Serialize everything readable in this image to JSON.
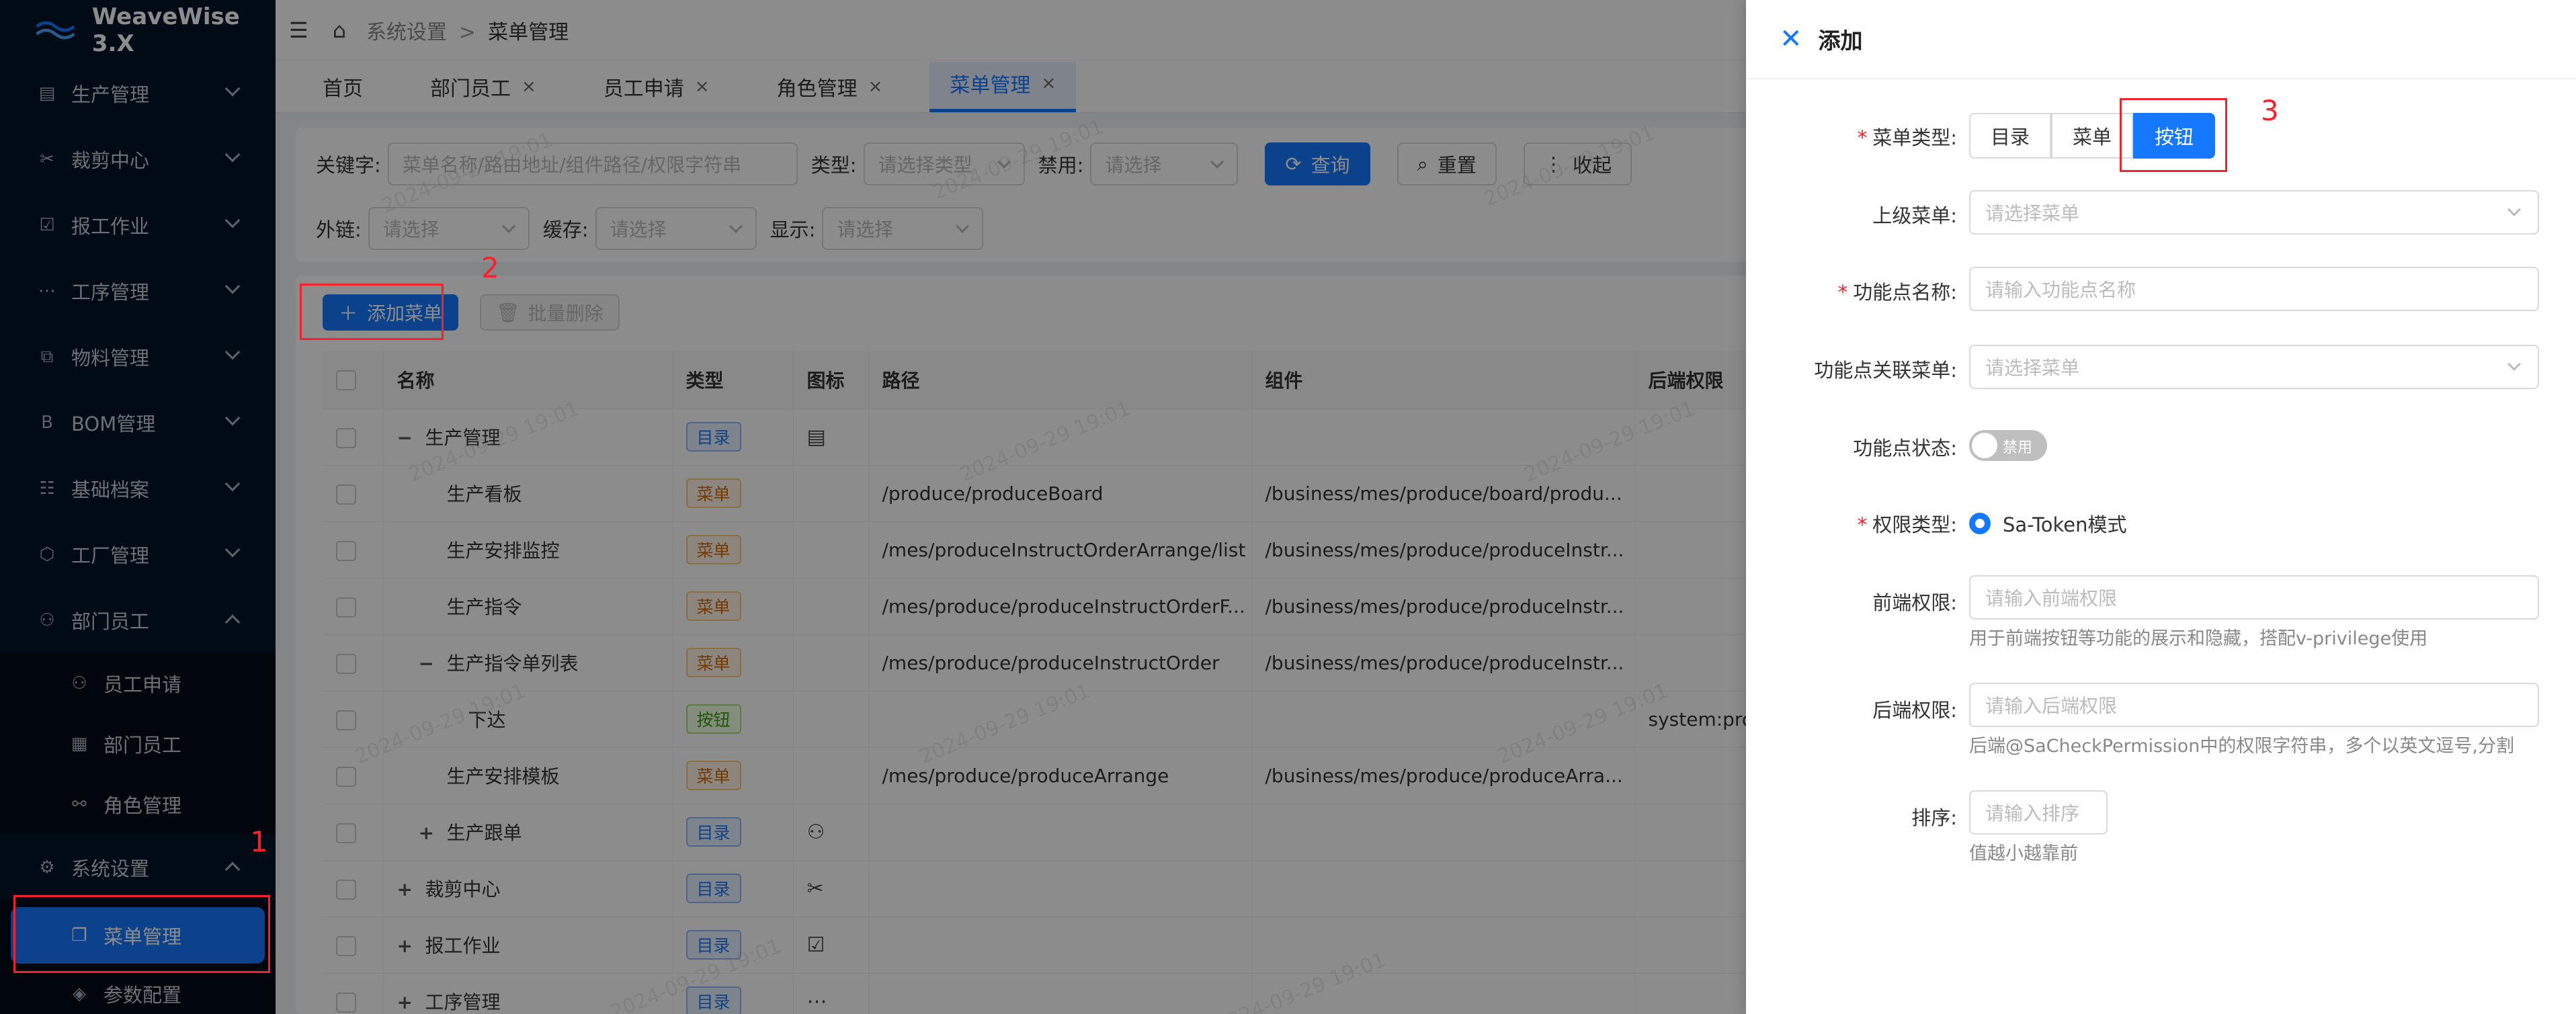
{
  "app": {
    "title": "WeaveWise 3.X"
  },
  "sidebar": {
    "items": [
      {
        "label": "生产管理",
        "icon": "clipboard-icon"
      },
      {
        "label": "裁剪中心",
        "icon": "scissors-icon"
      },
      {
        "label": "报工作业",
        "icon": "check-square-icon"
      },
      {
        "label": "工序管理",
        "icon": "ellipsis-icon"
      },
      {
        "label": "物料管理",
        "icon": "hierarchy-icon"
      },
      {
        "label": "BOM管理",
        "icon": "b-letter-icon"
      },
      {
        "label": "基础档案",
        "icon": "list-icon"
      },
      {
        "label": "工厂管理",
        "icon": "cube-icon"
      },
      {
        "label": "部门员工",
        "icon": "user-icon"
      }
    ],
    "dept_sub": [
      {
        "label": "员工申请",
        "icon": "user-icon"
      },
      {
        "label": "部门员工",
        "icon": "document-icon"
      },
      {
        "label": "角色管理",
        "icon": "role-icon"
      }
    ],
    "settings": {
      "label": "系统设置",
      "icon": "gear-icon"
    },
    "settings_sub": [
      {
        "label": "菜单管理",
        "icon": "copy-icon"
      },
      {
        "label": "参数配置",
        "icon": "diamond-icon"
      }
    ]
  },
  "breadcrumb": {
    "parent": "系统设置",
    "separator": ">",
    "current": "菜单管理"
  },
  "tabs": [
    {
      "label": "首页"
    },
    {
      "label": "部门员工"
    },
    {
      "label": "员工申请"
    },
    {
      "label": "角色管理"
    },
    {
      "label": "菜单管理"
    }
  ],
  "tab_close": "×",
  "filters": {
    "keyword_label": "关键字:",
    "keyword_placeholder": "菜单名称/路由地址/组件路径/权限字符串",
    "type_label": "类型:",
    "type_placeholder": "请选择类型",
    "disabled_label": "禁用:",
    "disabled_placeholder": "请选择",
    "query_btn": "查询",
    "reset_btn": "重置",
    "collapse_btn": "收起",
    "external_label": "外链:",
    "external_placeholder": "请选择",
    "cache_label": "缓存:",
    "cache_placeholder": "请选择",
    "show_label": "显示:",
    "show_placeholder": "请选择"
  },
  "toolbar": {
    "add_btn": "添加菜单",
    "batch_delete_btn": "批量删除"
  },
  "table": {
    "headers": [
      "名称",
      "类型",
      "图标",
      "路径",
      "组件",
      "后端权限"
    ],
    "rows": [
      {
        "expander": "−",
        "indent": 0,
        "name": "生产管理",
        "type": "目录",
        "tag": "blue",
        "icon": "clipboard-icon",
        "icon_glyph": "▤",
        "path": "",
        "component": "",
        "perm": ""
      },
      {
        "expander": "",
        "indent": 1,
        "name": "生产看板",
        "type": "菜单",
        "tag": "orange",
        "icon": "",
        "icon_glyph": "",
        "path": "/produce/produceBoard",
        "component": "/business/mes/produce/board/produ...",
        "perm": ""
      },
      {
        "expander": "",
        "indent": 1,
        "name": "生产安排监控",
        "type": "菜单",
        "tag": "orange",
        "icon": "",
        "icon_glyph": "",
        "path": "/mes/produceInstructOrderArrange/list",
        "component": "/business/mes/produce/produceInstr...",
        "perm": ""
      },
      {
        "expander": "",
        "indent": 1,
        "name": "生产指令",
        "type": "菜单",
        "tag": "orange",
        "icon": "",
        "icon_glyph": "",
        "path": "/mes/produce/produceInstructOrderF...",
        "component": "/business/mes/produce/produceInstr...",
        "perm": ""
      },
      {
        "expander": "−",
        "indent": 1,
        "name": "生产指令单列表",
        "type": "菜单",
        "tag": "orange",
        "icon": "",
        "icon_glyph": "",
        "path": "/mes/produce/produceInstructOrder",
        "component": "/business/mes/produce/produceInstr...",
        "perm": ""
      },
      {
        "expander": "",
        "indent": 2,
        "name": "下达",
        "type": "按钮",
        "tag": "green",
        "icon": "",
        "icon_glyph": "",
        "path": "",
        "component": "",
        "perm": "system:produce:issued"
      },
      {
        "expander": "",
        "indent": 1,
        "name": "生产安排模板",
        "type": "菜单",
        "tag": "orange",
        "icon": "",
        "icon_glyph": "",
        "path": "/mes/produce/produceArrange",
        "component": "/business/mes/produce/produceArra...",
        "perm": ""
      },
      {
        "expander": "+",
        "indent": 1,
        "name": "生产跟单",
        "type": "目录",
        "tag": "blue",
        "icon": "user-icon",
        "icon_glyph": "⚇",
        "path": "",
        "component": "",
        "perm": ""
      },
      {
        "expander": "+",
        "indent": 0,
        "name": "裁剪中心",
        "type": "目录",
        "tag": "blue",
        "icon": "scissors-icon",
        "icon_glyph": "✂",
        "path": "",
        "component": "",
        "perm": ""
      },
      {
        "expander": "+",
        "indent": 0,
        "name": "报工作业",
        "type": "目录",
        "tag": "blue",
        "icon": "check-square-icon",
        "icon_glyph": "☑",
        "path": "",
        "component": "",
        "perm": ""
      },
      {
        "expander": "+",
        "indent": 0,
        "name": "工序管理",
        "type": "目录",
        "tag": "blue",
        "icon": "ellipsis-icon",
        "icon_glyph": "⋯",
        "path": "",
        "component": "",
        "perm": ""
      }
    ]
  },
  "drawer": {
    "title": "添加",
    "menu_type_label": "菜单类型",
    "menu_type_options": [
      "目录",
      "菜单",
      "按钮"
    ],
    "menu_type_selected": "按钮",
    "parent_label": "上级菜单",
    "parent_placeholder": "请选择菜单",
    "func_name_label": "功能点名称",
    "func_name_placeholder": "请输入功能点名称",
    "func_menu_label": "功能点关联菜单",
    "func_menu_placeholder": "请选择菜单",
    "func_status_label": "功能点状态",
    "func_status_text": "禁用",
    "perm_type_label": "权限类型",
    "perm_type_value": "Sa-Token模式",
    "front_perm_label": "前端权限",
    "front_perm_placeholder": "请输入前端权限",
    "front_perm_help": "用于前端按钮等功能的展示和隐藏，搭配v-privilege使用",
    "back_perm_label": "后端权限",
    "back_perm_placeholder": "请输入后端权限",
    "back_perm_help": "后端@SaCheckPermission中的权限字符串，多个以英文逗号,分割",
    "sort_label": "排序",
    "sort_placeholder": "请输入排序",
    "sort_help": "值越小越靠前",
    "colon": ":"
  },
  "annotations": [
    "1",
    "2",
    "3"
  ],
  "watermark": "2024-09-29 19:01",
  "colors": {
    "primary": "#1677ff",
    "sidebar_bg": "#001529",
    "annotation": "#f5222d"
  }
}
